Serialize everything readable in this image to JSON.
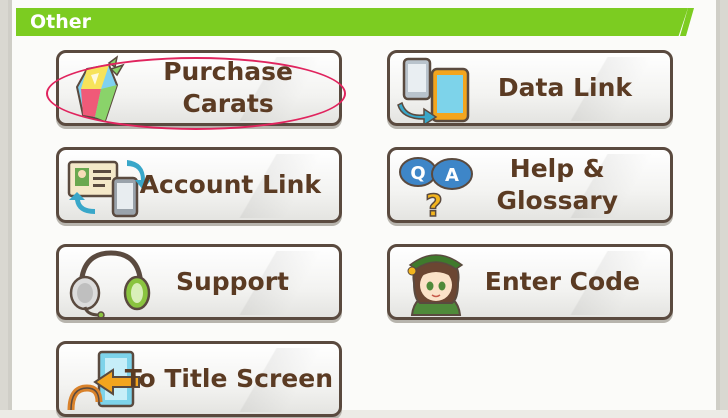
{
  "section": {
    "title": "Other"
  },
  "buttons": {
    "purchase_carats": {
      "label_line1": "Purchase",
      "label_line2": "Carats",
      "icon": "carat-crystal-icon"
    },
    "data_link": {
      "label": "Data Link",
      "icon": "phone-transfer-icon"
    },
    "account_link": {
      "label": "Account Link",
      "icon": "id-card-phone-icon"
    },
    "help_glossary": {
      "label_line1": "Help &",
      "label_line2": "Glossary",
      "icon": "qa-bubbles-icon"
    },
    "support": {
      "label": "Support",
      "icon": "headset-icon"
    },
    "enter_code": {
      "label": "Enter Code",
      "icon": "character-girl-icon"
    },
    "to_title_screen": {
      "label": "To Title Screen",
      "icon": "exit-arrow-icon"
    }
  },
  "colors": {
    "header": "#7ccc21",
    "button_text": "#5b3b23",
    "button_border": "#5a4a3f",
    "highlight": "#e0245e"
  }
}
